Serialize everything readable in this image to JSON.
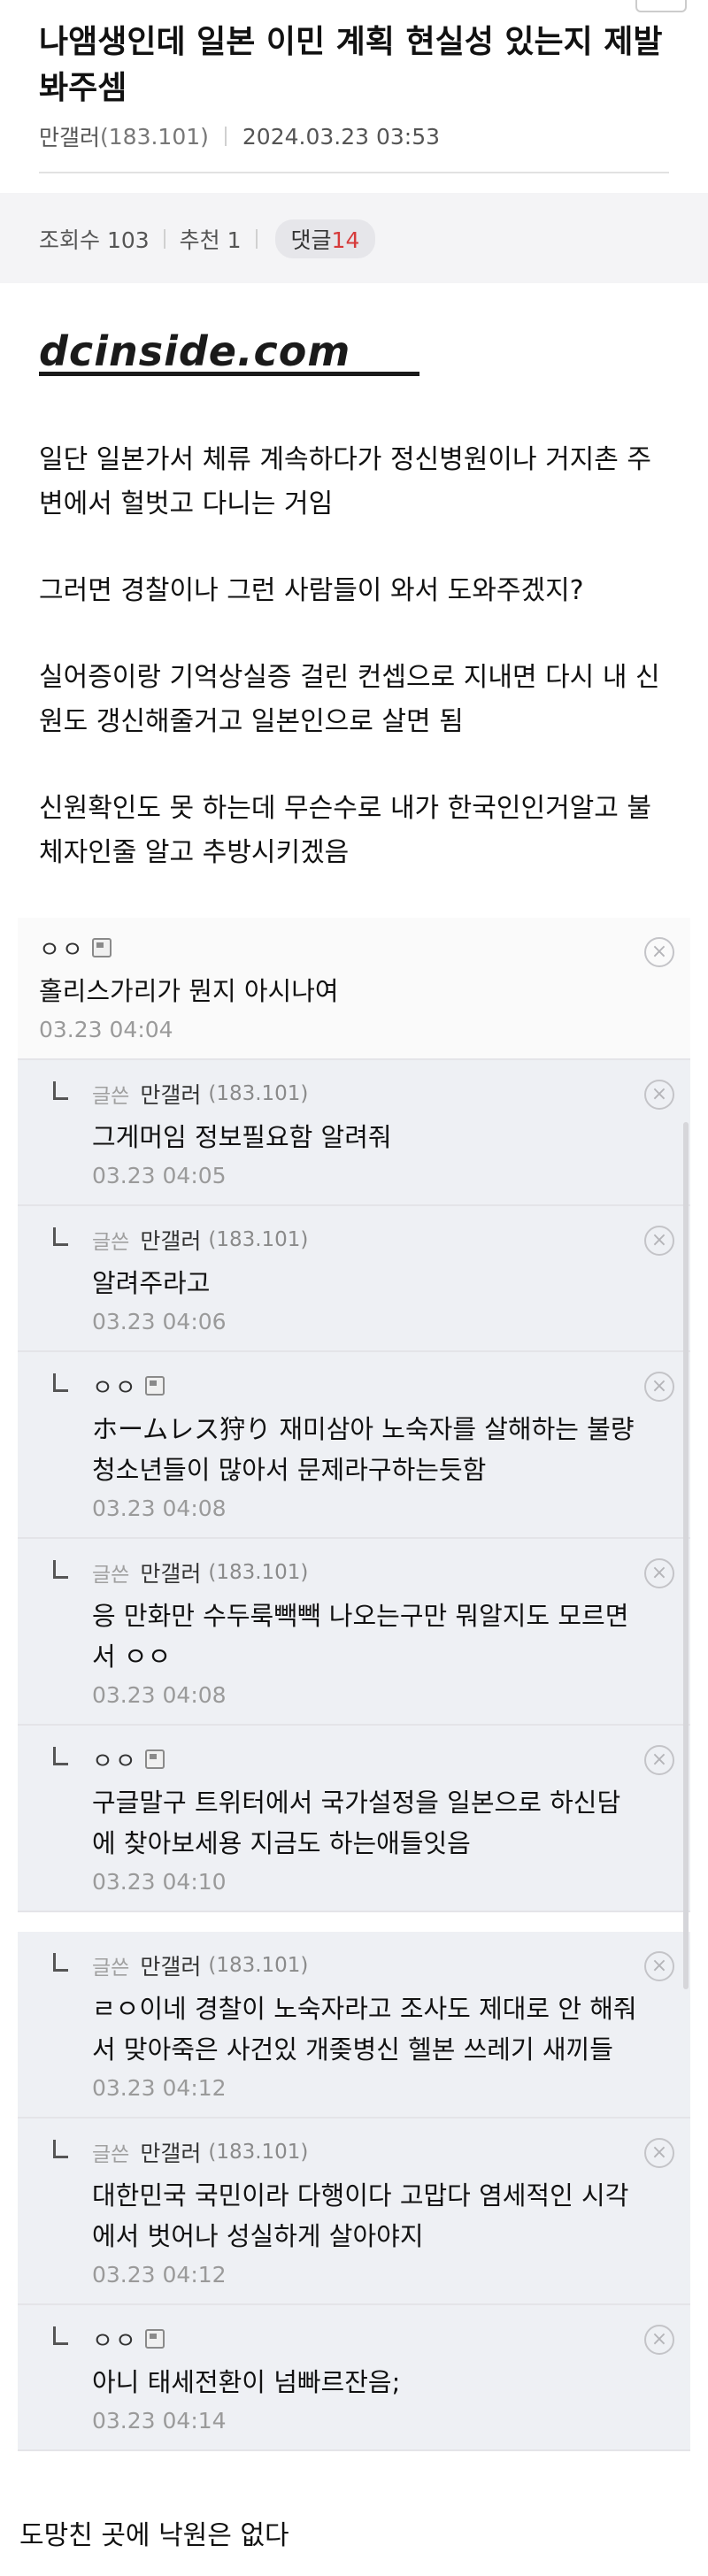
{
  "post": {
    "title": "나앰생인데 일본 이민 계획 현실성 있는지 제발 봐주셈",
    "author": "만갤러",
    "author_ip": "(183.101)",
    "datetime": "2024.03.23 03:53"
  },
  "stats": {
    "views_label": "조회수 103",
    "recommend_label": "추천 1",
    "comments_label": "댓글",
    "comments_count": "14"
  },
  "logo": {
    "text": "dcinside.com"
  },
  "body": {
    "paragraphs": [
      "일단 일본가서 체류 계속하다가 정신병원이나 거지촌 주변에서 헐벗고 다니는 거임",
      "그러면 경찰이나 그런 사람들이 와서 도와주겠지?",
      "실어증이랑 기억상실증 걸린 컨셉으로 지내면 다시 내 신원도 갱신해줄거고 일본인으로 살면 됨",
      "신원확인도 못 하는데 무슨수로 내가 한국인인거알고 불체자인줄 알고 추방시키겠음"
    ]
  },
  "comments": [
    {
      "nick": "ㅇㅇ",
      "text": "홀리스가리가 뭔지 아시나여",
      "date": "03.23 04:04"
    },
    {
      "badge": "글쓴",
      "nick": "만갤러",
      "ip": "(183.101)",
      "text": "그게머임 정보필요함 알려줘",
      "date": "03.23 04:05"
    },
    {
      "badge": "글쓴",
      "nick": "만갤러",
      "ip": "(183.101)",
      "text": "알려주라고",
      "date": "03.23 04:06"
    },
    {
      "nick": "ㅇㅇ",
      "text": "ホームレス狩り 재미삼아 노숙자를 살해하는 불량청소년들이 많아서 문제라구하는듯함",
      "date": "03.23 04:08"
    },
    {
      "badge": "글쓴",
      "nick": "만갤러",
      "ip": "(183.101)",
      "text": "응 만화만 수두룩빽빽 나오는구만 뭐알지도 모르면서 ㅇㅇ",
      "date": "03.23 04:08"
    },
    {
      "nick": "ㅇㅇ",
      "text": "구글말구 트위터에서 국가설정을 일본으로 하신담에 찾아보세용 지금도 하는애들잇음",
      "date": "03.23 04:10"
    },
    {
      "badge": "글쓴",
      "nick": "만갤러",
      "ip": "(183.101)",
      "text": "ㄹㅇ이네 경찰이 노숙자라고 조사도 제대로 안 해줘서 맞아죽은 사건있     개좆병신 헬본 쓰레기 새끼들",
      "date": "03.23 04:12"
    },
    {
      "badge": "글쓴",
      "nick": "만갤러",
      "ip": "(183.101)",
      "text": "대한민국 국민이라 다행이다 고맙다 염세적인 시각에서 벗어나 성실하게 살아야지",
      "date": "03.23 04:12"
    },
    {
      "nick": "ㅇㅇ",
      "text": "아니 태세전환이 넘빠르잔음;",
      "date": "03.23 04:14"
    }
  ],
  "icons": {
    "close": "×"
  },
  "footer": {
    "text": "도망친 곳에 낙원은 없다"
  }
}
